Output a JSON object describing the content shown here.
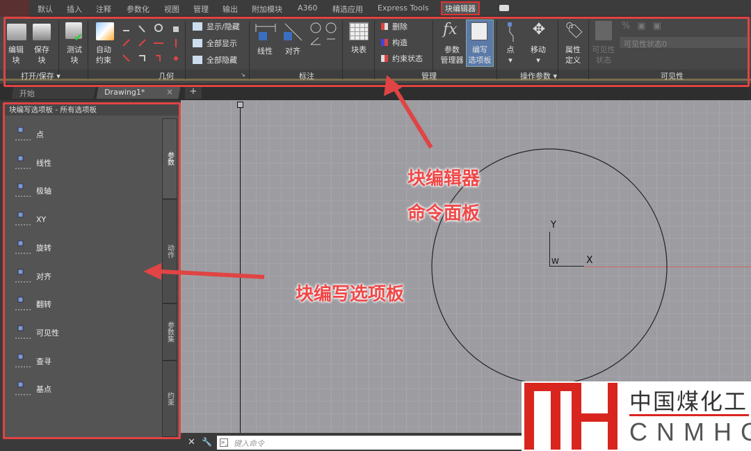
{
  "menu_tabs": [
    "默认",
    "插入",
    "注释",
    "参数化",
    "视图",
    "管理",
    "输出",
    "附加模块",
    "A360",
    "精选应用",
    "Express Tools",
    "块编辑器"
  ],
  "active_tab": "块编辑器",
  "ribbon": {
    "open_save": {
      "edit_block": "编辑\n块",
      "save_block": "保存\n块",
      "test_block": "测试\n块",
      "label": "打开/保存 ▾"
    },
    "geometry": {
      "auto_constrain": "自动\n约束",
      "label": "几何"
    },
    "show_hide": [
      "显示/隐藏",
      "全部显示",
      "全部隐藏"
    ],
    "dimension": {
      "linear": "线性",
      "aligned": "对齐",
      "label": "标注"
    },
    "block_table": "块表",
    "manage": {
      "items": [
        "删除",
        "构造",
        "约束状态"
      ],
      "param_manager": "参数\n管理器",
      "authoring_palettes": "编写\n选项板",
      "label": "管理"
    },
    "action_params": {
      "point": "点",
      "move": "移动",
      "label": "操作参数 ▾"
    },
    "attribute_def": "属性\n定义",
    "visibility": {
      "vis_state_btn": "可见性\n状态",
      "state_value": "可见性状态0",
      "label": "可见性"
    }
  },
  "file_tabs": {
    "start": "开始",
    "drawing": "Drawing1*",
    "close": "×",
    "add": "+"
  },
  "palette": {
    "title": "块编写选项板 - 所有选项板",
    "items": [
      "点",
      "线性",
      "极轴",
      "XY",
      "旋转",
      "对齐",
      "翻转",
      "可见性",
      "查寻",
      "基点"
    ],
    "side_tabs": [
      "参数",
      "动作",
      "参数集",
      "约束"
    ]
  },
  "ucs": {
    "x": "X",
    "y": "Y",
    "w": "W"
  },
  "command": {
    "placeholder": "键入命令"
  },
  "annotations": {
    "ribbon_line1": "块编辑器",
    "ribbon_line2": "命令面板",
    "palette": "块编写选项板"
  },
  "logo": {
    "mark": "MH",
    "cn": "中国煤化工",
    "en": "CNMHG"
  },
  "colors": {
    "annotation": "#e04444",
    "canvas": "#9c9ca1",
    "ribbon": "#474747"
  }
}
